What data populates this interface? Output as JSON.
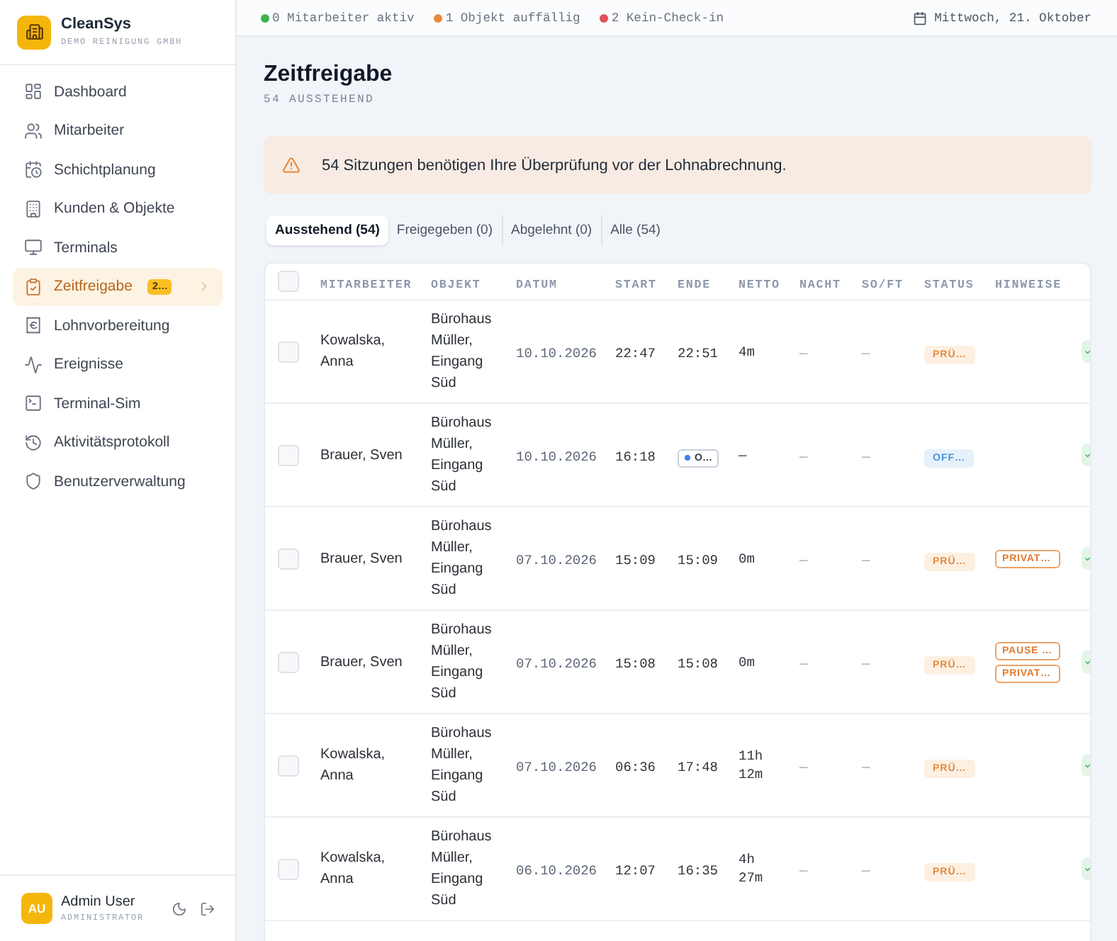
{
  "sidebar": {
    "brand": {
      "name": "CleanSys",
      "subtitle": "DEMO REINIGUNG GMBH"
    },
    "items": [
      {
        "label": "Dashboard",
        "selected": false
      },
      {
        "label": "Mitarbeiter",
        "selected": false
      },
      {
        "label": "Schichtplanung",
        "selected": false
      },
      {
        "label": "Kunden & Objekte",
        "selected": false
      },
      {
        "label": "Terminals",
        "selected": false
      },
      {
        "label": "Zeitfreigabe",
        "selected": true,
        "badge": "2…"
      },
      {
        "label": "Lohnvorbereitung",
        "selected": false
      },
      {
        "label": "Ereignisse",
        "selected": false
      },
      {
        "label": "Terminal-Sim",
        "selected": false
      },
      {
        "label": "Aktivitätsprotokoll",
        "selected": false
      },
      {
        "label": "Benutzerverwaltung",
        "selected": false
      }
    ],
    "user": {
      "initials": "AU",
      "name": "Admin User",
      "role": "ADMINISTRATOR"
    }
  },
  "status_bar": {
    "indicators": [
      {
        "text": "0 Mitarbeiter aktiv",
        "color": "#3cb44b"
      },
      {
        "text": "1 Objekt auffällig",
        "color": "#e8883a"
      },
      {
        "text": "2 Kein-Check-in",
        "color": "#e0505a"
      }
    ],
    "date": "Mittwoch, 21. Oktober"
  },
  "page": {
    "title": "Zeitfreigabe",
    "subtitle": "54 AUSSTEHEND"
  },
  "alert": {
    "text": "54 Sitzungen benötigen Ihre Überprüfung vor der Lohnabrechnung."
  },
  "tabs": [
    {
      "label": "Ausstehend (54)",
      "selected": true
    },
    {
      "label": "Freigegeben (0)",
      "selected": false
    },
    {
      "label": "Abgelehnt (0)",
      "selected": false
    },
    {
      "label": "Alle (54)",
      "selected": false
    }
  ],
  "table": {
    "select_all": {
      "checked": false
    },
    "columns": [
      "MITARBEITER",
      "OBJEKT",
      "DATUM",
      "START",
      "ENDE",
      "NETTO",
      "NACHT",
      "SO/FT",
      "STATUS",
      "HINWEISE"
    ],
    "rows": [
      {
        "checked": false,
        "employee": "Kowalska, Anna",
        "object": "Bürohaus Müller, Eingang Süd",
        "date": "10.10.2026",
        "start": "22:47",
        "end": {
          "kind": "time",
          "text": "22:51"
        },
        "net": "4m",
        "night": "—",
        "holiday": "—",
        "status": {
          "kind": "review",
          "text": "PRÜ…"
        }
      },
      {
        "checked": false,
        "employee": "Brauer, Sven",
        "object": "Bürohaus Müller, Eingang Süd",
        "date": "10.10.2026",
        "start": "16:18",
        "end": {
          "kind": "open",
          "text": "O…"
        },
        "net": "—",
        "night": "—",
        "holiday": "—",
        "status": {
          "kind": "open",
          "text": "OFF…"
        }
      },
      {
        "checked": false,
        "employee": "Brauer, Sven",
        "object": "Bürohaus Müller, Eingang Süd",
        "date": "07.10.2026",
        "start": "15:09",
        "end": {
          "kind": "time",
          "text": "15:09"
        },
        "net": "0m",
        "night": "—",
        "holiday": "—",
        "status": {
          "kind": "review",
          "text": "PRÜ…"
        },
        "notes": [
          "PRIVAT…"
        ]
      },
      {
        "checked": false,
        "employee": "Brauer, Sven",
        "object": "Bürohaus Müller, Eingang Süd",
        "date": "07.10.2026",
        "start": "15:08",
        "end": {
          "kind": "time",
          "text": "15:08"
        },
        "net": "0m",
        "night": "—",
        "holiday": "—",
        "status": {
          "kind": "review",
          "text": "PRÜ…"
        },
        "notes": [
          "PAUSE …",
          "PRIVAT…"
        ]
      },
      {
        "checked": false,
        "employee": "Kowalska, Anna",
        "object": "Bürohaus Müller, Eingang Süd",
        "date": "07.10.2026",
        "start": "06:36",
        "end": {
          "kind": "time",
          "text": "17:48"
        },
        "net": "11h 12m",
        "night": "—",
        "holiday": "—",
        "status": {
          "kind": "review",
          "text": "PRÜ…"
        }
      },
      {
        "checked": false,
        "employee": "Kowalska, Anna",
        "object": "Bürohaus Müller, Eingang Süd",
        "date": "06.10.2026",
        "start": "12:07",
        "end": {
          "kind": "time",
          "text": "16:35"
        },
        "net": "4h 27m",
        "night": "—",
        "holiday": "—",
        "status": {
          "kind": "review",
          "text": "PRÜ…"
        }
      }
    ]
  }
}
